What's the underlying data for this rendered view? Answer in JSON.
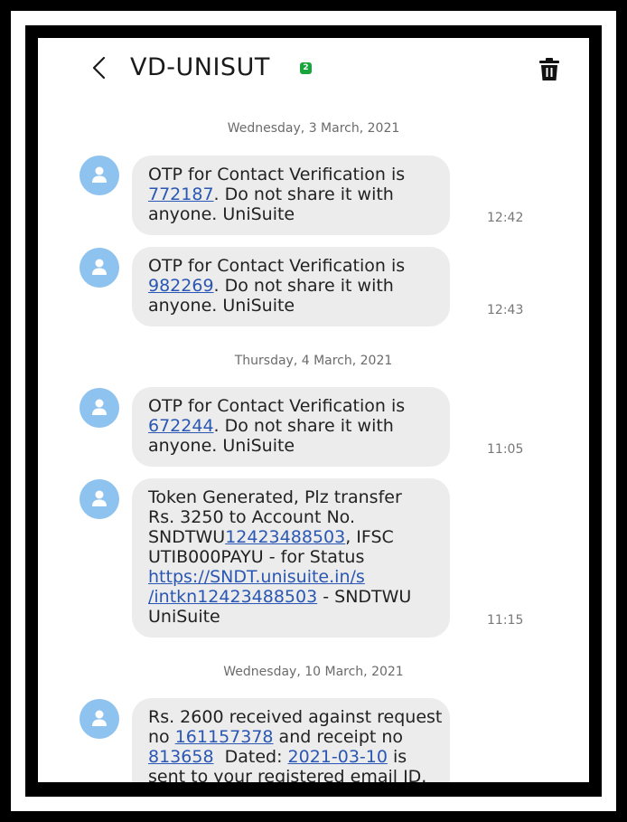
{
  "header": {
    "title": "VD-UNISUT",
    "sim_badge": "2"
  },
  "dates": {
    "d1": "Wednesday, 3 March, 2021",
    "d2": "Thursday, 4 March, 2021",
    "d3": "Wednesday, 10 March, 2021"
  },
  "messages": [
    {
      "time": "12:42",
      "l1": "OTP for Contact Verification is",
      "l2_link": "772187",
      "l2_text": ". Do not share it with",
      "l3": "anyone. UniSuite"
    },
    {
      "time": "12:43",
      "l1": "OTP for Contact Verification is",
      "l2_link": "982269",
      "l2_text": ". Do not share it with",
      "l3": "anyone. UniSuite"
    },
    {
      "time": "11:05",
      "l1": "OTP for Contact Verification is",
      "l2_link": "672244",
      "l2_text": ". Do not share it with",
      "l3": "anyone. UniSuite"
    },
    {
      "time": "11:15",
      "l1": "Token Generated, Plz transfer",
      "l2": "Rs. 3250 to Account No.",
      "l3_pre": "SNDTWU",
      "l3_link": "12423488503",
      "l3_post": ", IFSC",
      "l4": "UTIB000PAYU - for Status",
      "l5_link": "https://SNDT.unisuite.in/s",
      "l6_link": "/intkn12423488503",
      "l6_post": " - SNDTWU",
      "l7": "UniSuite"
    },
    {
      "l1": "Rs. 2600 received against request",
      "l2_pre": "no ",
      "l2_link": "161157378",
      "l2_post": " and receipt no",
      "l3_link1": "813658",
      "l3_mid": "  Dated: ",
      "l3_link2": "2021-03-10",
      "l3_post": " is",
      "l4": "sent to your registered email ID."
    }
  ],
  "colors": {
    "bubble": "#ececec",
    "link": "#2a57b3",
    "avatar": "#8ec3ef",
    "badge": "#17a53c"
  },
  "icons": {
    "back": "chevron-left-icon",
    "delete": "trash-icon",
    "avatar": "person-icon"
  }
}
